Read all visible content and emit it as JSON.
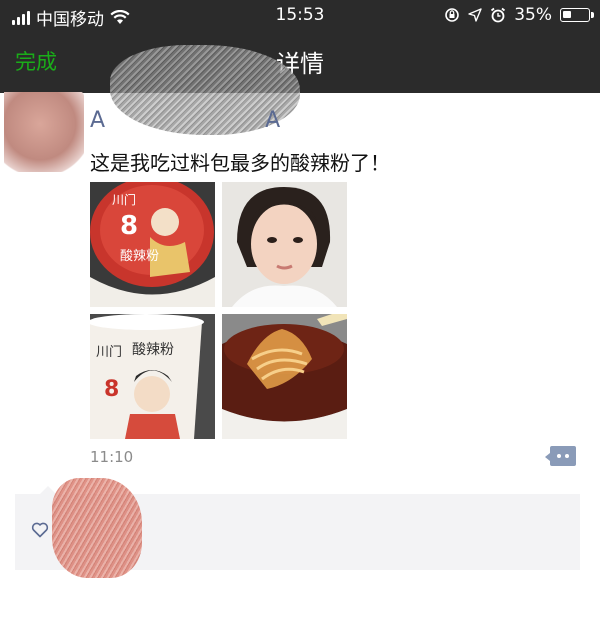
{
  "status_bar": {
    "carrier": "中国移动",
    "time": "15:53",
    "battery": "35%",
    "battery_level": 0.35,
    "icons": [
      "signal-icon",
      "wifi-icon",
      "orientation-lock-icon",
      "location-icon",
      "alarm-icon",
      "battery-icon"
    ]
  },
  "nav": {
    "done_label": "完成",
    "title": "详情"
  },
  "post": {
    "username": "A",
    "username_suffix": "A",
    "text": "这是我吃过料包最多的酸辣粉了！",
    "time": "11:10",
    "photos": [
      {
        "label": "川门",
        "subtitle": "酸辣粉",
        "number": "8"
      },
      {
        "label": ""
      },
      {
        "label": "川门",
        "subtitle": "酸辣粉",
        "number": "8"
      },
      {
        "label": ""
      }
    ]
  },
  "likes": {
    "icon": "heart-outline-icon"
  },
  "colors": {
    "nav_bg": "#2b2b2b",
    "done_green": "#1aad19",
    "username_blue": "#5b6a92",
    "likes_bg": "#f3f3f5",
    "comment_btn": "#8a9bb8"
  }
}
